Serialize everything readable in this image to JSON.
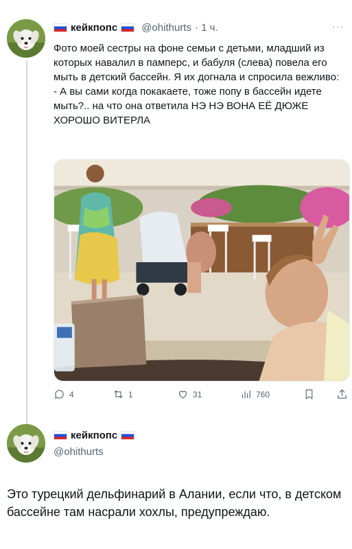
{
  "tweet": {
    "author_name": "кейкпопс",
    "handle": "@ohithurts",
    "time": "· 1 ч.",
    "more_icon": "ellipsis-icon",
    "text": "Фото моей сестры на фоне семьи с детьми, младший из которых навалил в памперс, и бабуля (слева) повела его мыть в детский бассейн. Я их догнала и спросила вежливо: - А вы сами когда покакаете, тоже попу в бассейн идете мыть?.. на что она ответила НЭ НЭ ВОНА ЕЁ ДЮЖЕ ХОРОШО ВИТЕРЛА",
    "actions": {
      "replies": "4",
      "reposts": "1",
      "likes": "31",
      "views": "760"
    }
  },
  "reply": {
    "author_name": "кейкпопс",
    "handle": "@ohithurts",
    "text": "Это турецкий дельфинарий в Алании, если что, в детском бассейне там насрали хохлы, предупреждаю."
  },
  "colors": {
    "text": "#0f1419",
    "secondary": "#536471",
    "thread_line": "#cfd9de"
  }
}
